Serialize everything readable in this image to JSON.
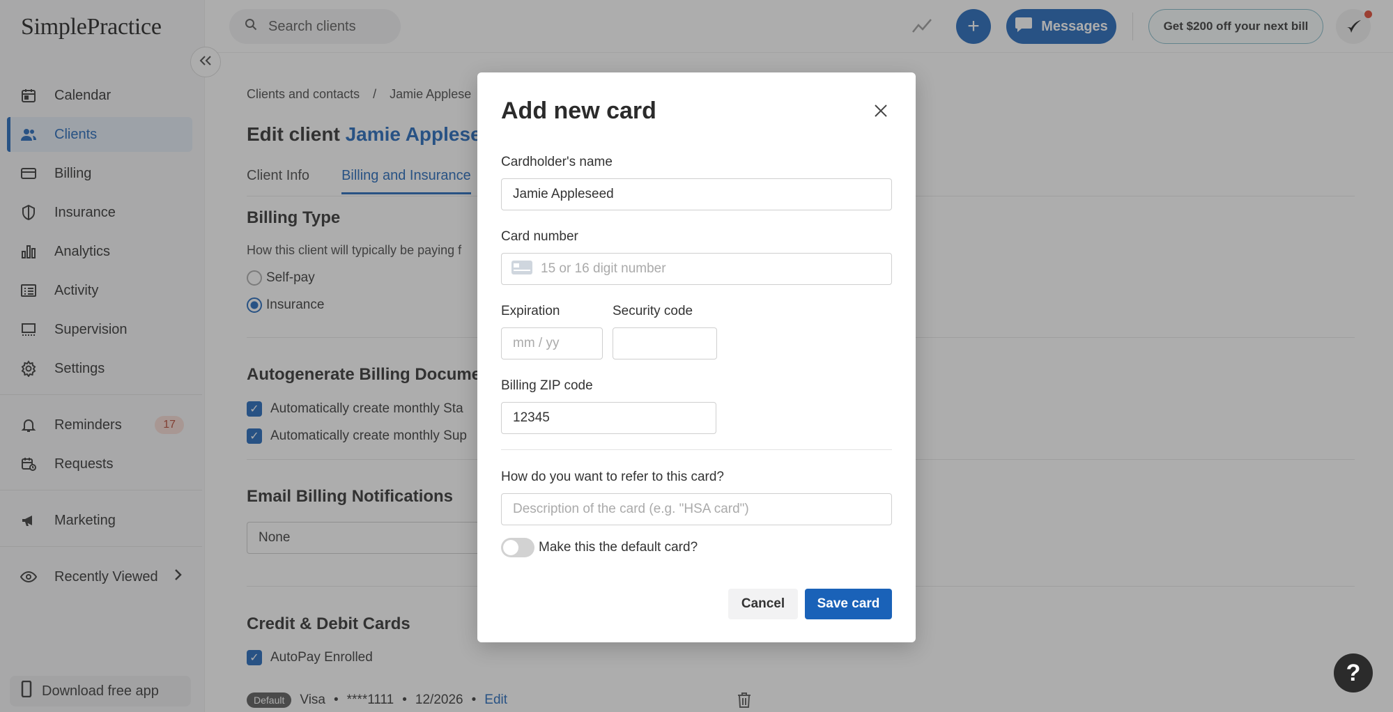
{
  "app": {
    "logo_text": "SimplePractice"
  },
  "sidebar": {
    "items": [
      {
        "label": "Calendar",
        "icon": "calendar-icon"
      },
      {
        "label": "Clients",
        "icon": "users-icon",
        "active": true
      },
      {
        "label": "Billing",
        "icon": "credit-card-icon"
      },
      {
        "label": "Insurance",
        "icon": "shield-icon"
      },
      {
        "label": "Analytics",
        "icon": "bar-chart-icon"
      },
      {
        "label": "Activity",
        "icon": "list-icon"
      },
      {
        "label": "Supervision",
        "icon": "supervision-icon"
      },
      {
        "label": "Settings",
        "icon": "gear-icon"
      }
    ],
    "reminders": {
      "label": "Reminders",
      "count": "17"
    },
    "requests": {
      "label": "Requests"
    },
    "marketing": {
      "label": "Marketing"
    },
    "recently_viewed": {
      "label": "Recently Viewed"
    },
    "download_app": "Download free app"
  },
  "topbar": {
    "search_placeholder": "Search clients",
    "messages_label": "Messages",
    "plus_label": "+",
    "promo_label": "Get $200 off your next bill"
  },
  "main": {
    "breadcrumb": {
      "parent": "Clients and contacts",
      "separator": "/",
      "current": "Jamie Applese"
    },
    "title_prefix": "Edit client",
    "title_client": "Jamie Appleseed",
    "tabs": [
      {
        "label": "Client Info"
      },
      {
        "label": "Billing and Insurance",
        "active": true
      }
    ],
    "billing_type": {
      "heading": "Billing Type",
      "description": "How this client will typically be paying f",
      "options": [
        {
          "label": "Self-pay",
          "checked": false
        },
        {
          "label": "Insurance",
          "checked": true
        }
      ]
    },
    "autogenerate": {
      "heading": "Autogenerate Billing Documen",
      "items": [
        {
          "label": "Automatically create monthly Sta",
          "checked": true
        },
        {
          "label": "Automatically create monthly Sup",
          "checked": true
        }
      ]
    },
    "email_notifications": {
      "heading": "Email Billing Notifications",
      "value": "None"
    },
    "cards": {
      "heading": "Credit & Debit Cards",
      "autopay_label": "AutoPay Enrolled",
      "card": {
        "default_label": "Default",
        "brand": "Visa",
        "dot": "•",
        "number": "****1111",
        "expiry": "12/2026",
        "edit_label": "Edit"
      }
    }
  },
  "modal": {
    "title": "Add new card",
    "cardholder_label": "Cardholder's name",
    "cardholder_value": "Jamie Appleseed",
    "card_number_label": "Card number",
    "card_number_placeholder": "15 or 16 digit number",
    "expiration_label": "Expiration",
    "expiration_placeholder": "mm / yy",
    "security_label": "Security code",
    "zip_label": "Billing ZIP code",
    "zip_value": "12345",
    "refer_label": "How do you want to refer to this card?",
    "refer_placeholder": "Description of the card (e.g. \"HSA card\")",
    "default_toggle_label": "Make this the default card?",
    "default_toggle_on": false,
    "cancel_label": "Cancel",
    "save_label": "Save card"
  },
  "help": {
    "label": "?"
  },
  "colors": {
    "accent": "#1a62b8",
    "badge_bg": "#f7d9d3",
    "badge_text": "#b4432e"
  }
}
